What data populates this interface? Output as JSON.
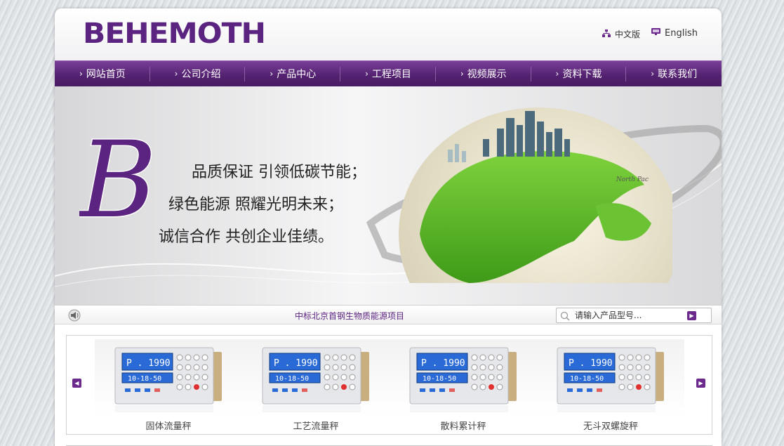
{
  "header": {
    "logo_text": "BEHEMOTH",
    "lang_cn": "中文版",
    "lang_en": "English",
    "brand_color": "#5b2480"
  },
  "nav": {
    "items": [
      {
        "label": "网站首页"
      },
      {
        "label": "公司介绍"
      },
      {
        "label": "产品中心"
      },
      {
        "label": "工程项目"
      },
      {
        "label": "视频展示"
      },
      {
        "label": "资料下载"
      },
      {
        "label": "联系我们"
      }
    ]
  },
  "banner": {
    "big_letter": "B",
    "slogan_1": "品质保证  引领低碳节能；",
    "slogan_2": "绿色能源  照耀光明未来；",
    "slogan_3": "诚信合作  共创企业佳绩。"
  },
  "newsbar": {
    "headline": "中标北京首钢生物质能源项目",
    "search_placeholder": "请输入产品型号..."
  },
  "products": {
    "items": [
      {
        "name": "固体流量秤",
        "display_top": "P . 1990",
        "display_bottom": "10-18-50"
      },
      {
        "name": "工艺流量秤",
        "display_top": "P . 1990",
        "display_bottom": "10-18-50"
      },
      {
        "name": "散料累计秤",
        "display_top": "P . 1990",
        "display_bottom": "10-18-50"
      },
      {
        "name": "无斗双螺旋秤",
        "display_top": "P . 1990",
        "display_bottom": "10-18-50"
      }
    ]
  }
}
